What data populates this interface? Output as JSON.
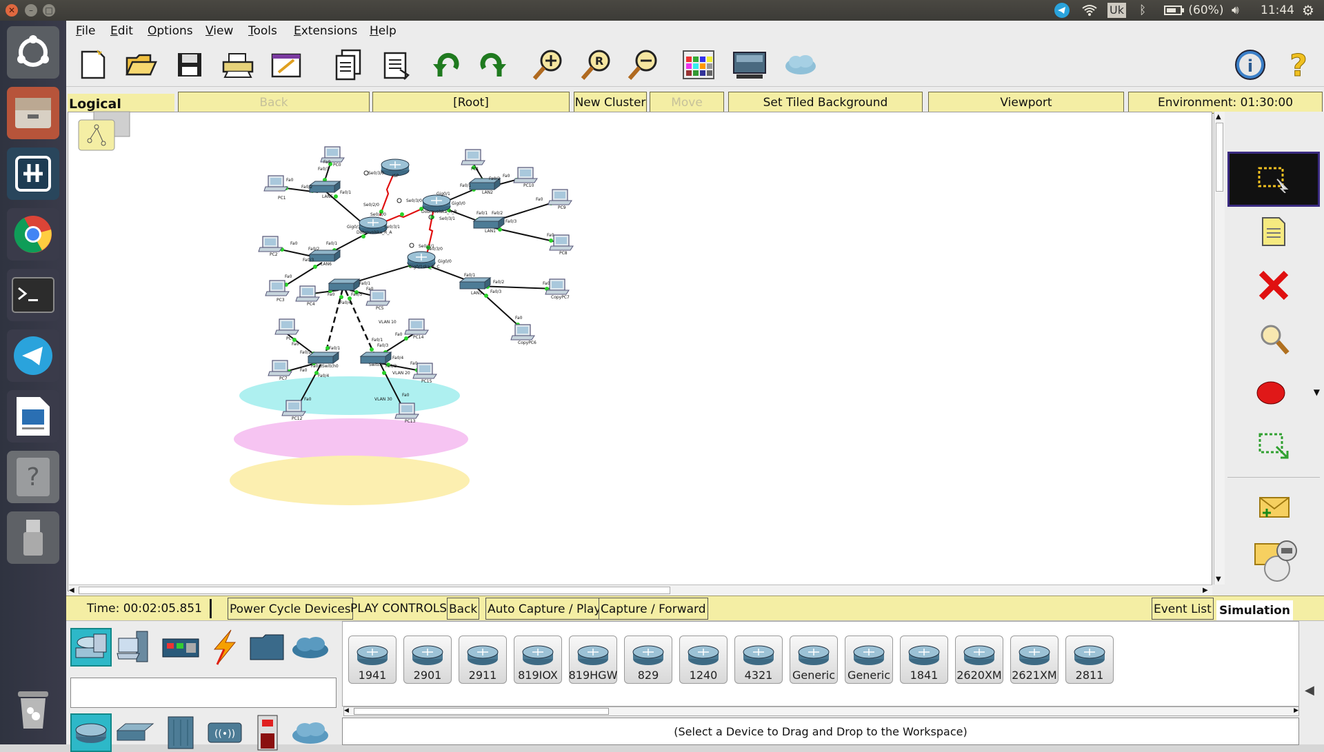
{
  "system": {
    "tray": {
      "keyboard_layout": "Uk",
      "battery": "(60%)",
      "clock": "11:44"
    }
  },
  "menu": {
    "items": [
      {
        "label": "File",
        "u": "F",
        "rest": "ile"
      },
      {
        "label": "Edit",
        "u": "E",
        "rest": "dit"
      },
      {
        "label": "Options",
        "u": "O",
        "rest": "ptions"
      },
      {
        "label": "View",
        "u": "V",
        "rest": "iew"
      },
      {
        "label": "Tools",
        "u": "T",
        "rest": "ools"
      },
      {
        "label": "Extensions",
        "u": "E",
        "rest": "xtensions"
      },
      {
        "label": "Help",
        "u": "H",
        "rest": "elp"
      }
    ]
  },
  "toolbar": {
    "icons": [
      "new-file-icon",
      "open-folder-icon",
      "save-icon",
      "print-icon",
      "activity-wizard-icon",
      "copy-icon",
      "paste-icon",
      "undo-icon",
      "redo-icon",
      "zoom-in-icon",
      "zoom-reset-icon",
      "zoom-out-icon",
      "palette-icon",
      "custom-device-icon",
      "cloud-icon",
      "info-icon",
      "help-icon"
    ]
  },
  "navbar": {
    "logical": "Logical",
    "back": "Back",
    "root": "[Root]",
    "new_cluster": "New Cluster",
    "move_object": "Move Object",
    "set_tiled_background": "Set Tiled Background",
    "viewport": "Viewport",
    "environment": "Environment: 01:30:00"
  },
  "topology": {
    "devices": {
      "pc_labels": [
        "PC1",
        "PC0",
        "PC10",
        "PC9",
        "PC8",
        "PC2",
        "PC3",
        "PC4",
        "PC5",
        "PC",
        "PC14",
        "PC7",
        "PC15",
        "PC12",
        "PC13",
        "CopyPC7",
        "CopyPC6",
        "PC1"
      ],
      "switch_labels": [
        "LAN5",
        "LAN2",
        "LAN1",
        "LAN6",
        "LAN3",
        "Switch",
        "Switch0"
      ],
      "router_labels": [
        "ISP",
        "Dobrovolska_R_B",
        "Dobrovolska_R_A",
        "ska_R_C"
      ],
      "vlan_labels": [
        "VLAN 10",
        "VLAN 20",
        "VLAN 30"
      ],
      "port_labels": [
        "Fa0",
        "Fa0/3",
        "Fa0/2",
        "Fa0/1",
        "Se0/3/0",
        "Se0/2/0",
        "Se0/3/1",
        "Gig0/1",
        "Gig0/0",
        "Fa0/4",
        "Fa0/5"
      ]
    }
  },
  "statusbar": {
    "time": "Time: 00:02:05.851",
    "power_cycle": "Power Cycle Devices",
    "play_controls": "PLAY CONTROLS:",
    "back": "Back",
    "auto_capture": "Auto Capture / Play",
    "capture_forward": "Capture / Forward",
    "event_list": "Event List",
    "simulation": "Simulation"
  },
  "devices_panel": {
    "search_value": "",
    "models": [
      "1941",
      "2901",
      "2911",
      "819IOX",
      "819HGW",
      "829",
      "1240",
      "4321",
      "Generic",
      "Generic",
      "1841",
      "2620XM",
      "2621XM",
      "2811"
    ],
    "hint": "(Select a Device to Drag and Drop to the Workspace)"
  }
}
